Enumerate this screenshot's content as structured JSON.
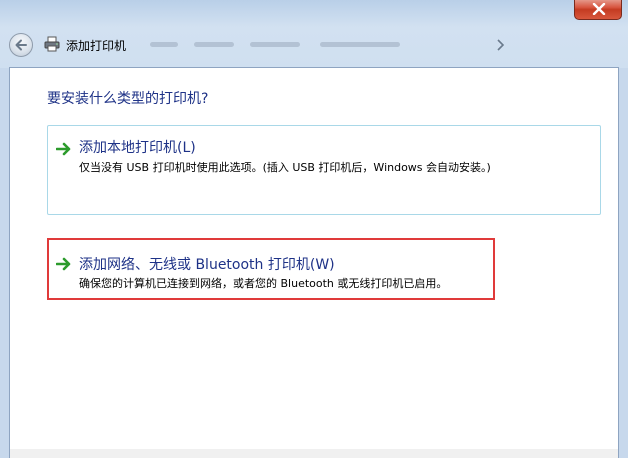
{
  "window": {
    "title": "添加打印机"
  },
  "page": {
    "heading": "要安装什么类型的打印机?"
  },
  "options": [
    {
      "title": "添加本地打印机(L)",
      "description": "仅当没有 USB 打印机时使用此选项。(插入 USB 打印机后，Windows 会自动安装。)"
    },
    {
      "title": "添加网络、无线或 Bluetooth 打印机(W)",
      "description": "确保您的计算机已连接到网络，或者您的 Bluetooth 或无线打印机已启用。"
    }
  ],
  "icons": {
    "back": "back-arrow-icon",
    "printer": "printer-icon",
    "option_arrow": "green-arrow-icon",
    "close": "close-icon"
  },
  "colors": {
    "heading": "#1e3287",
    "arrow": "#2c9b2c",
    "highlight": "#e03a3a"
  }
}
